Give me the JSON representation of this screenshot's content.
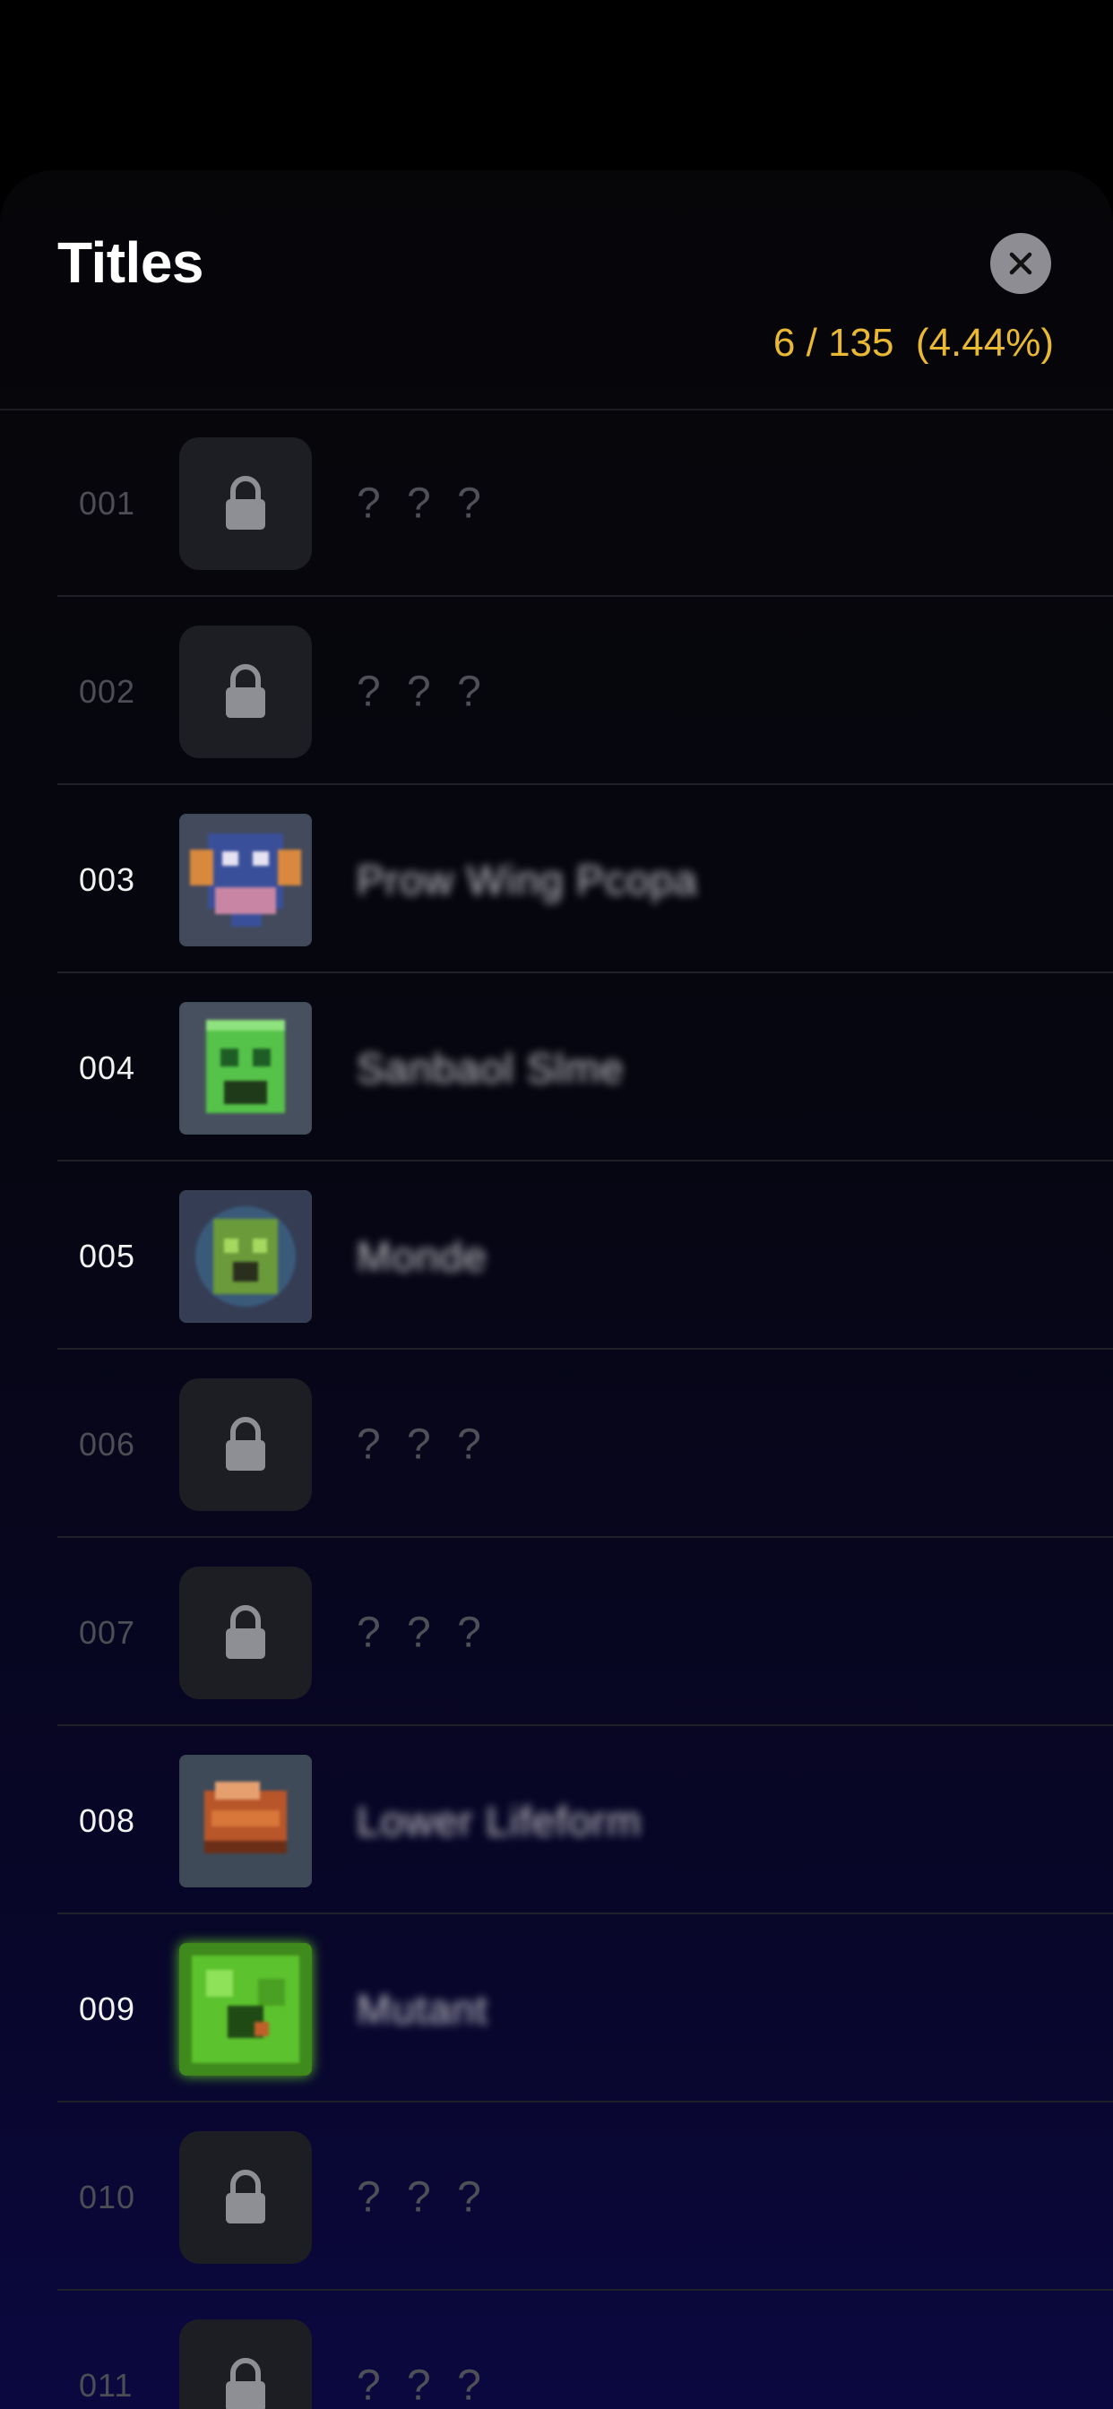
{
  "header": {
    "title": "Titles",
    "progress": "6 / 135  (4.44%)"
  },
  "colors": {
    "accent": "#e9b933",
    "locked_text": "#4d4d55",
    "tile_bg": "#1d1d24"
  },
  "items": [
    {
      "number": "001",
      "name": "? ? ?",
      "unlocked": false,
      "icon": "lock-icon"
    },
    {
      "number": "002",
      "name": "? ? ?",
      "unlocked": false,
      "icon": "lock-icon"
    },
    {
      "number": "003",
      "name": "Prow Wing Pcopa",
      "unlocked": true,
      "icon": "pixel-creature-blue-icon"
    },
    {
      "number": "004",
      "name": "Sanbaol Slme",
      "unlocked": true,
      "icon": "pixel-slime-green-icon"
    },
    {
      "number": "005",
      "name": "Monde",
      "unlocked": true,
      "icon": "pixel-creature-face-icon"
    },
    {
      "number": "006",
      "name": "? ? ?",
      "unlocked": false,
      "icon": "lock-icon"
    },
    {
      "number": "007",
      "name": "? ? ?",
      "unlocked": false,
      "icon": "lock-icon"
    },
    {
      "number": "008",
      "name": "Lower Lifeform",
      "unlocked": true,
      "icon": "pixel-creature-orange-icon"
    },
    {
      "number": "009",
      "name": "Mutant",
      "unlocked": true,
      "icon": "pixel-mutant-green-icon"
    },
    {
      "number": "010",
      "name": "? ? ?",
      "unlocked": false,
      "icon": "lock-icon"
    },
    {
      "number": "011",
      "name": "? ? ?",
      "unlocked": false,
      "icon": "lock-icon"
    }
  ]
}
